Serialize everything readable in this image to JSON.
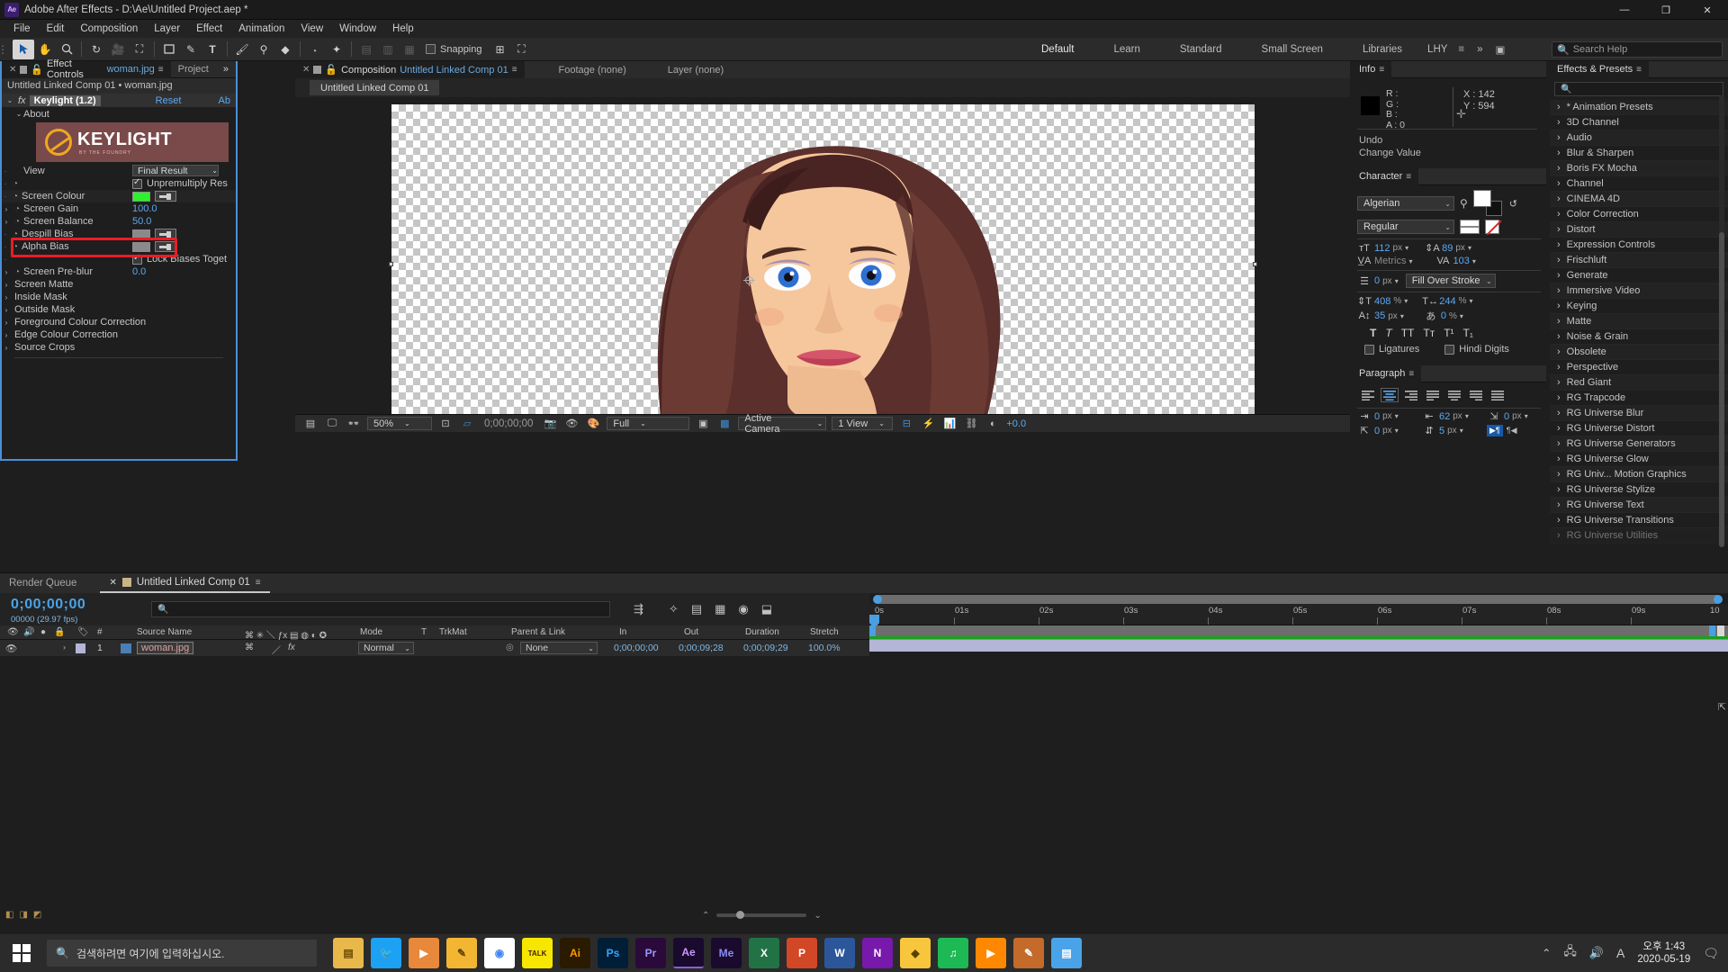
{
  "window": {
    "app_icon": "Ae",
    "title": "Adobe After Effects - D:\\Ae\\Untitled Project.aep *",
    "minimize": "—",
    "maximize": "❐",
    "close": "✕"
  },
  "menubar": [
    "File",
    "Edit",
    "Composition",
    "Layer",
    "Effect",
    "Animation",
    "View",
    "Window",
    "Help"
  ],
  "toolbar": {
    "snapping_label": "Snapping",
    "workspaces": [
      "Default",
      "Learn",
      "Standard",
      "Small Screen",
      "Libraries"
    ],
    "user_initials": "LHY",
    "overflow": "»",
    "search_placeholder": "Search Help"
  },
  "effect_controls": {
    "tabs": [
      {
        "label": "Effect Controls",
        "file": "woman.jpg",
        "active": true
      },
      {
        "label": "Project",
        "active": false
      }
    ],
    "header": "Untitled Linked Comp 01 • woman.jpg",
    "effect_name": "Keylight (1.2)",
    "reset_label": "Reset",
    "about_link": "Ab",
    "about_label": "About",
    "banner": {
      "title": "KEYLIGHT",
      "subtitle": "BY THE FOUNDRY"
    },
    "properties": [
      {
        "label": "View",
        "value": "Final Result",
        "type": "dropdown"
      },
      {
        "label": "",
        "value": "Unpremultiply Res",
        "type": "checkbox",
        "checked": true
      },
      {
        "label": "Screen Colour",
        "value": "",
        "type": "color",
        "color": "#2bf32b",
        "selected": true
      },
      {
        "label": "Screen Gain",
        "value": "100.0",
        "type": "number",
        "expand": true
      },
      {
        "label": "Screen Balance",
        "value": "50.0",
        "type": "number",
        "expand": true
      },
      {
        "label": "Despill Bias",
        "value": "",
        "type": "color",
        "color": "#8a8a8a"
      },
      {
        "label": "Alpha Bias",
        "value": "",
        "type": "color",
        "color": "#8a8a8a"
      },
      {
        "label": "",
        "value": "Lock Biases Toget",
        "type": "checkbox",
        "checked": true
      },
      {
        "label": "Screen Pre-blur",
        "value": "0.0",
        "type": "number",
        "expand": true
      },
      {
        "label": "Screen Matte",
        "value": "",
        "type": "group"
      },
      {
        "label": "Inside Mask",
        "value": "",
        "type": "group"
      },
      {
        "label": "Outside Mask",
        "value": "",
        "type": "group"
      },
      {
        "label": "Foreground Colour Correction",
        "value": "",
        "type": "group"
      },
      {
        "label": "Edge Colour Correction",
        "value": "",
        "type": "group"
      },
      {
        "label": "Source Crops",
        "value": "",
        "type": "group"
      }
    ]
  },
  "composition": {
    "tabs": [
      {
        "label": "Composition",
        "name": "Untitled Linked Comp 01",
        "active": true
      },
      {
        "label": "Footage (none)",
        "active": false
      },
      {
        "label": "Layer (none)",
        "active": false
      }
    ],
    "sub_tab": "Untitled Linked Comp 01",
    "viewer_bar": {
      "zoom": "50%",
      "time": "0;00;00;00",
      "resolution": "Full",
      "camera": "Active Camera",
      "views": "1 View",
      "exposure": "+0.0"
    }
  },
  "info": {
    "title": "Info",
    "r": "R :",
    "g": "G :",
    "b": "B :",
    "a": "A : 0",
    "x": "X : 142",
    "y": "Y : 594",
    "undo_label": "Undo",
    "undo_action": "Change Value"
  },
  "character": {
    "title": "Character",
    "font_family": "Algerian",
    "font_style": "Regular",
    "font_size": "112",
    "font_size_unit": "px",
    "leading": "89",
    "leading_unit": "px",
    "kerning": "Metrics",
    "tracking": "103",
    "stroke_width": "0",
    "stroke_width_unit": "px",
    "stroke_order": "Fill Over Stroke",
    "vertical_scale": "408",
    "vertical_scale_unit": "%",
    "horizontal_scale": "244",
    "horizontal_scale_unit": "%",
    "baseline_shift": "35",
    "baseline_shift_unit": "px",
    "tsume": "0",
    "tsume_unit": "%",
    "styles": [
      "T",
      "T",
      "TT",
      "Tт",
      "T¹",
      "T₁"
    ],
    "ligatures_label": "Ligatures",
    "hindi_label": "Hindi Digits"
  },
  "paragraph": {
    "title": "Paragraph",
    "indent_left": "0",
    "indent_left_unit": "px",
    "indent_right": "62",
    "indent_right_unit": "px",
    "indent_first": "0",
    "indent_first_unit": "px",
    "space_before": "0",
    "space_before_unit": "px",
    "space_after": "5",
    "space_after_unit": "px"
  },
  "effects_presets": {
    "title": "Effects & Presets",
    "search_placeholder": "",
    "items": [
      "* Animation Presets",
      "3D Channel",
      "Audio",
      "Blur & Sharpen",
      "Boris FX Mocha",
      "Channel",
      "CINEMA 4D",
      "Color Correction",
      "Distort",
      "Expression Controls",
      "Frischluft",
      "Generate",
      "Immersive Video",
      "Keying",
      "Matte",
      "Noise & Grain",
      "Obsolete",
      "Perspective",
      "Red Giant",
      "RG Trapcode",
      "RG Universe Blur",
      "RG Universe Distort",
      "RG Universe Generators",
      "RG Universe Glow",
      "RG Univ... Motion Graphics",
      "RG Universe Stylize",
      "RG Universe Text",
      "RG Universe Transitions",
      "RG Universe Utilities"
    ]
  },
  "timeline": {
    "tabs": [
      {
        "label": "Render Queue",
        "active": false
      },
      {
        "label": "Untitled Linked Comp 01",
        "active": true
      }
    ],
    "current_time": "0;00;00;00",
    "frame_info": "00000 (29.97 fps)",
    "search_placeholder": "",
    "columns": [
      "Source Name",
      "Mode",
      "T",
      "TrkMat",
      "Parent & Link",
      "In",
      "Out",
      "Duration",
      "Stretch"
    ],
    "layer": {
      "index": "1",
      "source_name": "woman.jpg",
      "mode": "Normal",
      "parent": "None",
      "in": "0;00;00;00",
      "out": "0;00;09;28",
      "duration": "0;00;09;29",
      "stretch": "100.0%"
    },
    "ruler_ticks": [
      "0s",
      "01s",
      "02s",
      "03s",
      "04s",
      "05s",
      "06s",
      "07s",
      "08s",
      "09s",
      "10"
    ]
  },
  "taskbar": {
    "search_placeholder": "검색하려면 여기에 입력하십시오.",
    "apps": [
      {
        "name": "file-explorer-icon",
        "glyph": "📁",
        "color": "#e8b84b"
      },
      {
        "name": "twitter-icon",
        "glyph": "🐦",
        "color": "#1da1f2"
      },
      {
        "name": "media-player-icon",
        "glyph": "▶",
        "color": "#e8883b"
      },
      {
        "name": "notes-icon",
        "glyph": "📝",
        "color": "#f2b632"
      },
      {
        "name": "chrome-icon",
        "glyph": "◉",
        "color": "#4285f4"
      },
      {
        "name": "kakaotalk-icon",
        "glyph": "TALK",
        "color": "#f7e600"
      },
      {
        "name": "illustrator-icon",
        "glyph": "Ai",
        "color": "#ff9a00"
      },
      {
        "name": "photoshop-icon",
        "glyph": "Ps",
        "color": "#31a8ff"
      },
      {
        "name": "premiere-icon",
        "glyph": "Pr",
        "color": "#9999ff"
      },
      {
        "name": "after-effects-icon",
        "glyph": "Ae",
        "color": "#cf96fd"
      },
      {
        "name": "media-encoder-icon",
        "glyph": "Me",
        "color": "#8b8bf5"
      },
      {
        "name": "excel-icon",
        "glyph": "X",
        "color": "#217346"
      },
      {
        "name": "powerpoint-icon",
        "glyph": "P",
        "color": "#d24726"
      },
      {
        "name": "word-icon",
        "glyph": "W",
        "color": "#2b579a"
      },
      {
        "name": "onenote-icon",
        "glyph": "N",
        "color": "#7719aa"
      },
      {
        "name": "sketch-icon",
        "glyph": "◆",
        "color": "#f8c63d"
      },
      {
        "name": "spotify-icon",
        "glyph": "♫",
        "color": "#1db954"
      },
      {
        "name": "vlc-icon",
        "glyph": "▶",
        "color": "#ff8800"
      },
      {
        "name": "editor-icon",
        "glyph": "✎",
        "color": "#c46a2a"
      },
      {
        "name": "explorer2-icon",
        "glyph": "▤",
        "color": "#4aa3e8"
      }
    ],
    "ime": "A",
    "time": "오후 1:43",
    "date": "2020-05-19"
  }
}
